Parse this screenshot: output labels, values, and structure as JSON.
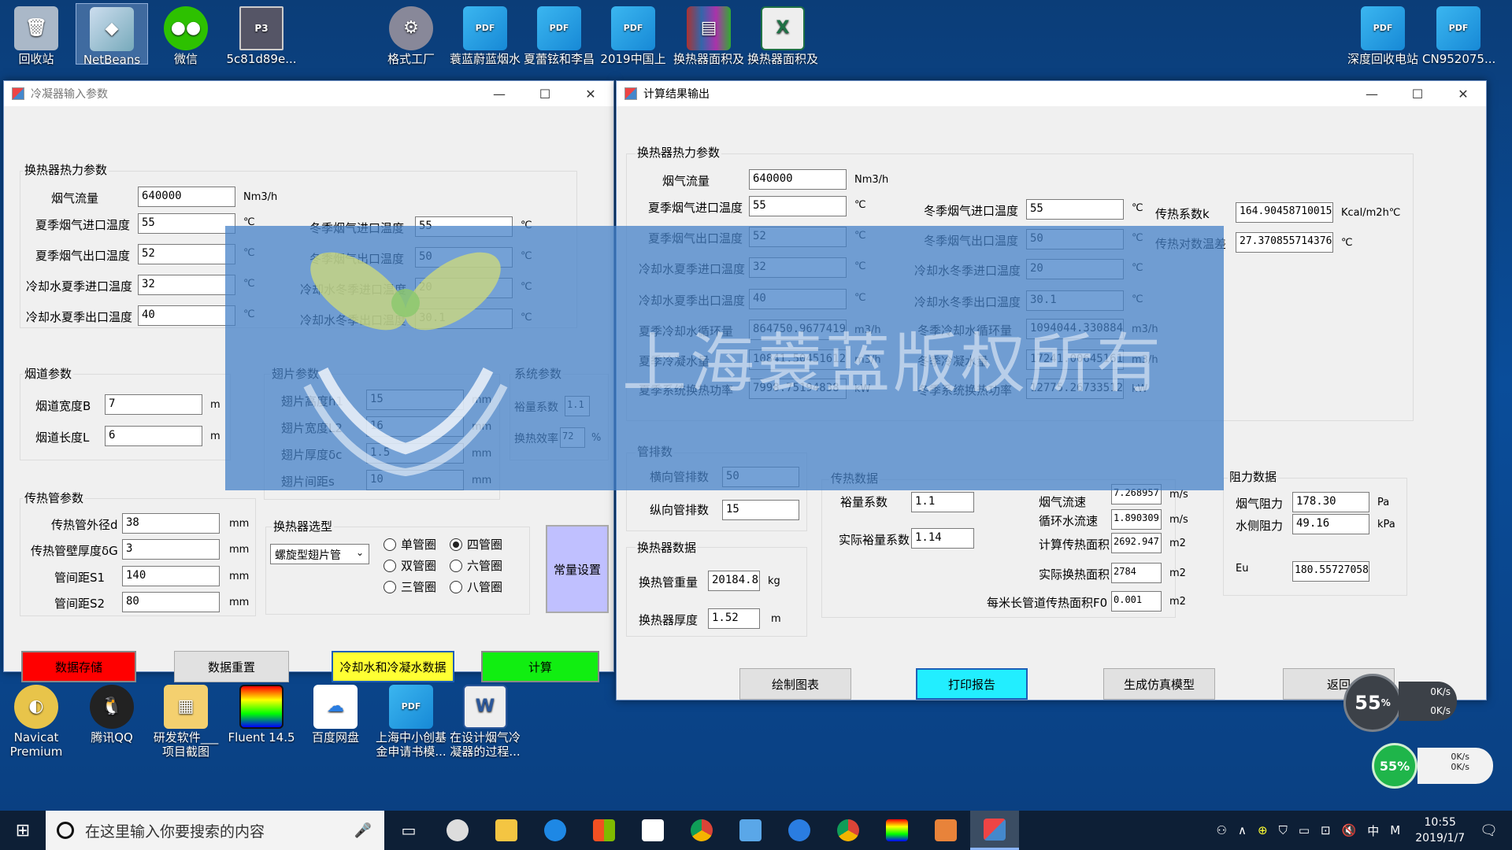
{
  "desktop": {
    "top_icons": [
      {
        "label": "回收站"
      },
      {
        "label": "NetBeans IDE 8.2"
      },
      {
        "label": "微信"
      },
      {
        "label": "5c81d89e..."
      },
      {
        "label": "格式工厂"
      },
      {
        "label": "蓑蓝蔚蓝烟水换热器启动..."
      },
      {
        "label": "夏蕾铉和李昌镇国模教育..."
      },
      {
        "label": "2019中国上海国际设计..."
      },
      {
        "label": "换热器面积及冷却水量计..."
      },
      {
        "label": "换热器面积及冷却水量计算..."
      },
      {
        "label": "深度回收电站锅炉烟气余..."
      },
      {
        "label": "CN952075...锅炉空气预..."
      }
    ],
    "bottom_icons": [
      {
        "label": "Navicat Premium"
      },
      {
        "label": "腾讯QQ"
      },
      {
        "label": "研发软件___项目截图"
      },
      {
        "label": "Fluent 14.5"
      },
      {
        "label": "百度网盘"
      },
      {
        "label": "上海中小创基金申请书模..."
      },
      {
        "label": "在设计烟气冷凝器的过程..."
      }
    ]
  },
  "left_window": {
    "title": "冷凝器输入参数",
    "thermal_group": {
      "title": "换热器热力参数",
      "flue_flow_label": "烟气流量",
      "flue_flow": "640000",
      "flue_flow_unit": "Nm3/h",
      "summer_in_label": "夏季烟气进口温度",
      "summer_in": "55",
      "summer_out_label": "夏季烟气出口温度",
      "summer_out": "52",
      "cw_summer_in_label": "冷却水夏季进口温度",
      "cw_summer_in": "32",
      "cw_summer_out_label": "冷却水夏季出口温度",
      "cw_summer_out": "40",
      "winter_in_label": "冬季烟气进口温度",
      "winter_in": "55",
      "winter_out_label": "冬季烟气出口温度",
      "winter_out": "50",
      "cw_winter_in_label": "冷却水冬季进口温度",
      "cw_winter_in": "20",
      "cw_winter_out_label": "冷却水冬季出口温度",
      "cw_winter_out": "30.1",
      "celsius": "℃"
    },
    "duct_group": {
      "title": "烟道参数",
      "width_label": "烟道宽度B",
      "width": "7",
      "length_label": "烟道长度L",
      "length": "6",
      "m": "m"
    },
    "fin_group": {
      "title": "翅片参数",
      "height_label": "翅片高度h1",
      "height": "15",
      "width_label": "翅片宽度L2",
      "width": "16",
      "thickness_label": "翅片厚度δc",
      "thickness": "1.5",
      "spacing_label": "翅片间距s",
      "spacing": "10",
      "mm": "mm"
    },
    "system_group": {
      "title": "系统参数",
      "margin_label": "裕量系数",
      "margin": "1.1",
      "efficiency_label": "换热效率",
      "efficiency": "72",
      "pct": "%"
    },
    "tube_group": {
      "title": "传热管参数",
      "od_label": "传热管外径d",
      "od": "38",
      "wall_label": "传热管壁厚度δG",
      "wall": "3",
      "s1_label": "管间距S1",
      "s1": "140",
      "s2_label": "管间距S2",
      "s2": "80",
      "mm": "mm"
    },
    "select_group": {
      "title": "换热器选型",
      "type_value": "螺旋型翅片管",
      "radios": [
        "单管圈",
        "四管圈",
        "双管圈",
        "六管圈",
        "三管圈",
        "八管圈"
      ],
      "selected": "四管圈"
    },
    "btn_common": "常量设置",
    "btn_save": "数据存储",
    "btn_reset": "数据重置",
    "btn_water": "冷却水和冷凝水数据",
    "btn_calc": "计算",
    "colors": {
      "save": "#ff0000",
      "water": "#ffff33",
      "calc": "#11ee11",
      "common": "#c0c0ff"
    }
  },
  "right_window": {
    "title": "计算结果输出",
    "thermal_group": {
      "title": "换热器热力参数",
      "flue_flow_label": "烟气流量",
      "flue_flow": "640000",
      "flue_flow_unit": "Nm3/h",
      "summer_in_label": "夏季烟气进口温度",
      "summer_in": "55",
      "summer_out_label": "夏季烟气出口温度",
      "summer_out": "52",
      "cw_summer_in_label": "冷却水夏季进口温度",
      "cw_summer_in": "32",
      "cw_summer_out_label": "冷却水夏季出口温度",
      "cw_summer_out": "40",
      "summer_circ_label": "夏季冷却水循环量",
      "summer_circ": "864750.96774193",
      "summer_cond_label": "夏季冷凝水量",
      "summer_cond": "10841.504516129",
      "summer_power_label": "夏季系统换热功率",
      "summer_power": "7998.75194838",
      "winter_in_label": "冬季烟气进口温度",
      "winter_in": "55",
      "winter_out_label": "冬季烟气出口温度",
      "winter_out": "50",
      "cw_winter_in_label": "冷却水冬季进口温度",
      "cw_winter_in": "20",
      "cw_winter_out_label": "冷却水冬季出口温度",
      "cw_winter_out": "30.1",
      "winter_circ_label": "冬季冷却水循环量",
      "winter_circ": "1094044.3308847",
      "winter_cond_label": "冬季冷凝水量",
      "winter_cond": "17241.00645161",
      "winter_power_label": "冬季系统换热功率",
      "winter_power": "12775.26733512",
      "k_label": "传热系数k",
      "k": "164.904587100159",
      "k_unit": "Kcal/m2h℃",
      "lmtd_label": "传热对数温差",
      "lmtd": "27.370855714376",
      "celsius": "℃",
      "m3h": "m3/h",
      "kw": "kW"
    },
    "tube_group": {
      "title": "管排数",
      "lateral_label": "横向管排数",
      "lateral": "50",
      "longitudinal_label": "纵向管排数",
      "longitudinal": "15"
    },
    "hx_group": {
      "title": "换热器数据",
      "weight_label": "换热管重量",
      "weight": "20184.81",
      "weight_unit": "kg",
      "thickness_label": "换热器厚度",
      "thickness": "1.52",
      "thickness_unit": "m"
    },
    "heat_group": {
      "title": "传热数据",
      "margin_label": "裕量系数",
      "margin": "1.1",
      "actual_margin_label": "实际裕量系数",
      "actual_margin": "1.14",
      "gas_velocity_label": "烟气流速",
      "gas_velocity": "7.268957",
      "water_velocity_label": "循环水流速",
      "water_velocity": "1.890309",
      "calc_area_label": "计算传热面积",
      "calc_area": "2692.947",
      "actual_area_label": "实际换热面积",
      "actual_area": "2784",
      "per_m_label": "每米长管道传热面积F0",
      "per_m": "0.001",
      "ms": "m/s",
      "m2": "m2"
    },
    "resist_group": {
      "title": "阻力数据",
      "gas_label": "烟气阻力",
      "gas": "178.30",
      "gas_unit": "Pa",
      "water_label": "水侧阻力",
      "water": "49.16",
      "water_unit": "kPa",
      "eu_label": "Eu",
      "eu": "180.55727058"
    },
    "btn_chart": "绘制图表",
    "btn_print": "打印报告",
    "btn_model": "生成仿真模型",
    "btn_back": "返回",
    "colors": {
      "print": "#22eeff"
    }
  },
  "watermark": "上海蓑蓝版权所有",
  "widgets": {
    "cpu_pct": "55",
    "cpu_unit": "%",
    "net_up": "0K/s",
    "net_down": "0K/s",
    "mem_pct": "55%",
    "up2": "0K/s",
    "down2": "0K/s"
  },
  "taskbar": {
    "search_placeholder": "在这里输入你要搜索的内容",
    "ime": "中",
    "time": "10:55",
    "date": "2019/1/7"
  }
}
